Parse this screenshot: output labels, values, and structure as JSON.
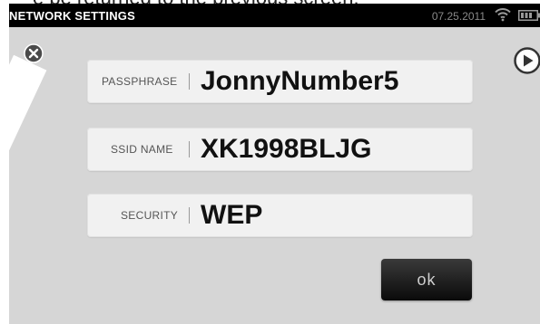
{
  "caption": {
    "text": "e be returned to the previous screen."
  },
  "status_bar": {
    "title": "NETWORK SETTINGS",
    "date": "07.25.2011",
    "wifi_icon": "wifi-icon",
    "battery_icon": "battery-icon"
  },
  "nav": {
    "close_icon": "close-icon",
    "next_icon": "play-arrow-icon"
  },
  "fields": [
    {
      "label": "PASSPHRASE",
      "value": "JonnyNumber5"
    },
    {
      "label": "SSID NAME",
      "value": "XK1998BLJG"
    },
    {
      "label": "SECURITY",
      "value": "WEP"
    }
  ],
  "ok_button": {
    "label": "ok"
  },
  "colors": {
    "status_bar_bg": "#000000",
    "screen_bg": "#d6d6d6",
    "field_bg": "#f1f1f1",
    "button_bg": "#111111"
  }
}
